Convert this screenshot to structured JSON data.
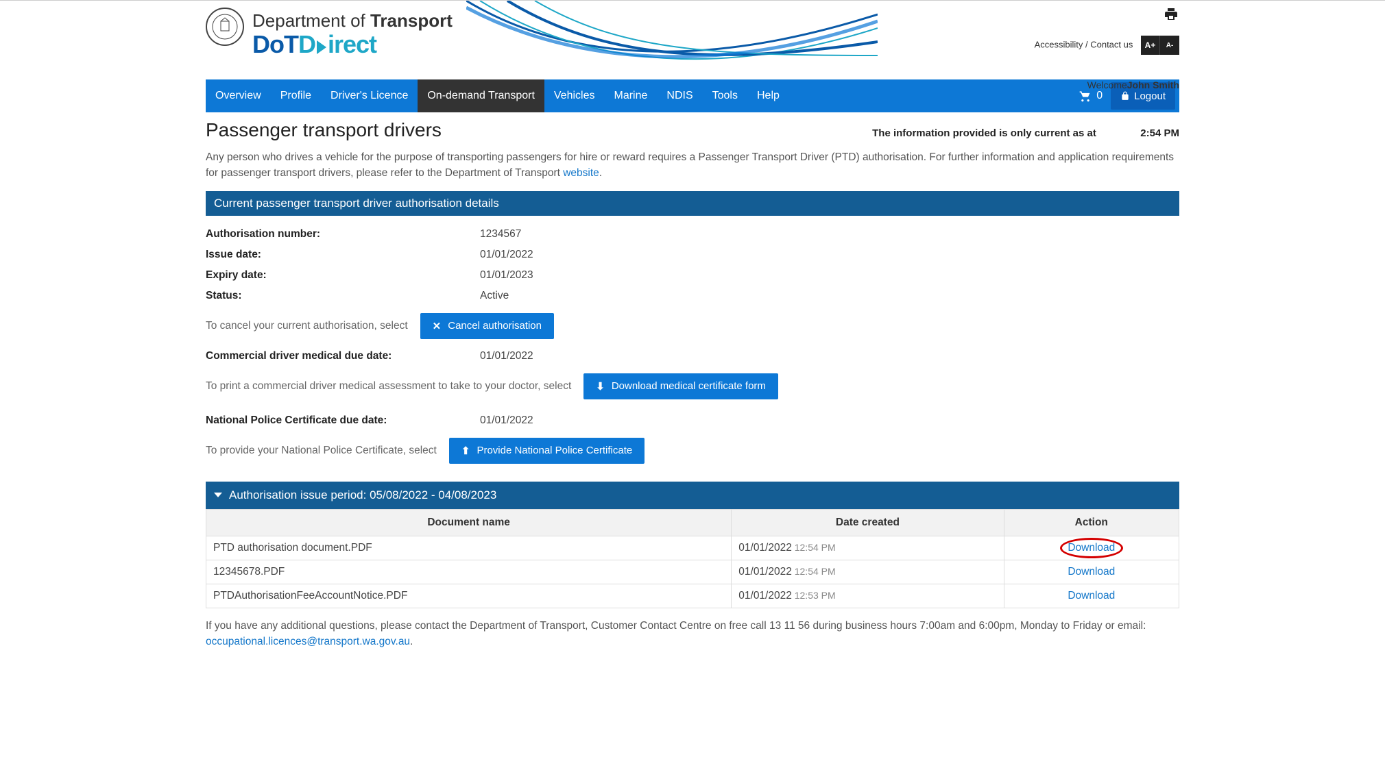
{
  "header": {
    "dept_prefix": "Department of ",
    "dept_bold": "Transport",
    "brand_dot": "DoT",
    "brand_direct": "irect",
    "accessibility": "Accessibility",
    "separator": " / ",
    "contact": "Contact us",
    "font_inc": "A+",
    "font_dec": "A-",
    "welcome_label": "Welcome",
    "welcome_name": "John Smith"
  },
  "nav": {
    "items": [
      "Overview",
      "Profile",
      "Driver's Licence",
      "On-demand Transport",
      "Vehicles",
      "Marine",
      "NDIS",
      "Tools",
      "Help"
    ],
    "cart_count": "0",
    "logout": "Logout"
  },
  "page": {
    "title": "Passenger transport drivers",
    "current_label": "The information provided is only current as at",
    "current_time": "2:54 PM",
    "intro_a": "Any person who drives a vehicle for the purpose of transporting passengers for hire or reward requires a Passenger Transport Driver (PTD) authorisation. For further information and application requirements for passenger transport drivers, please refer to the Department of Transport ",
    "intro_link": "website",
    "intro_b": "."
  },
  "section": {
    "title": "Current passenger transport driver authorisation details",
    "auth_number_label": "Authorisation number:",
    "auth_number": "1234567",
    "issue_label": "Issue date:",
    "issue": "01/01/2022",
    "expiry_label": "Expiry date:",
    "expiry": "01/01/2023",
    "status_label": "Status:",
    "status": "Active",
    "cancel_instr": "To cancel your current authorisation, select",
    "cancel_btn": "Cancel authorisation",
    "med_label": "Commercial driver medical due date:",
    "med_date": "01/01/2022",
    "med_instr": "To print a commercial driver medical assessment to take to your doctor, select",
    "med_btn": "Download medical certificate form",
    "npc_label": "National Police Certificate due date:",
    "npc_date": "01/01/2022",
    "npc_instr": "To provide your National Police Certificate, select",
    "npc_btn": "Provide National Police Certificate"
  },
  "accordion": {
    "label": "Authorisation issue period: 05/08/2022 - 04/08/2023"
  },
  "table": {
    "headers": [
      "Document name",
      "Date created",
      "Action"
    ],
    "rows": [
      {
        "name": "PTD authorisation document.PDF",
        "date": "01/01/2022",
        "time": "12:54 PM",
        "action": "Download",
        "highlight": true
      },
      {
        "name": "12345678.PDF",
        "date": "01/01/2022",
        "time": "12:54 PM",
        "action": "Download",
        "highlight": false
      },
      {
        "name": "PTDAuthorisationFeeAccountNotice.PDF",
        "date": "01/01/2022",
        "time": "12:53 PM",
        "action": "Download",
        "highlight": false
      }
    ]
  },
  "footer": {
    "text_a": "If you have any additional questions, please contact the Department of Transport, Customer Contact Centre on free call 13 11 56 during business hours 7:00am and 6:00pm, Monday to Friday or email: ",
    "email": "occupational.licences@transport.wa.gov.au",
    "text_b": "."
  }
}
